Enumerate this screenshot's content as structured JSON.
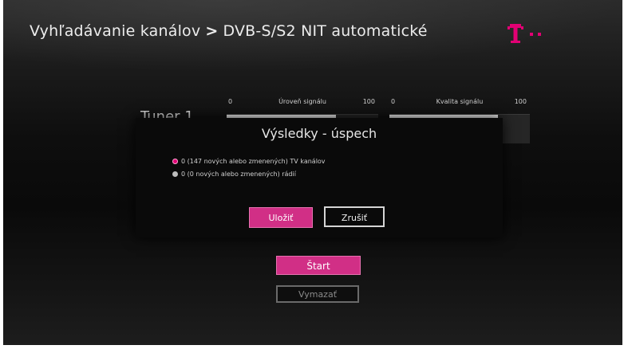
{
  "header": {
    "section": "Vyhľadávanie kanálov",
    "separator": ">",
    "subsection": "DVB-S/S2 NIT automatické"
  },
  "brand": {
    "logo_icon": "telekom-t-logo-icon",
    "color": "#e20074"
  },
  "tuner": {
    "label": "Tuner 1",
    "signal_meter": {
      "label": "Úroveň signálu",
      "min": "0",
      "max": "100",
      "level_percent": 72
    },
    "quality_meter": {
      "label": "Kvalita signálu",
      "min": "0",
      "max": "100",
      "level_percent": 77
    }
  },
  "dialog": {
    "title": "Výsledky - úspech",
    "results": [
      {
        "text": "0 (147 nových alebo zmenených) TV kanálov",
        "bullet": "pink"
      },
      {
        "text": "0 (0 nových alebo zmenených) rádií",
        "bullet": "grey"
      }
    ],
    "save_label": "Uložiť",
    "cancel_label": "Zrušiť"
  },
  "actions": {
    "start_label": "Štart",
    "clear_label": "Vymazať"
  }
}
